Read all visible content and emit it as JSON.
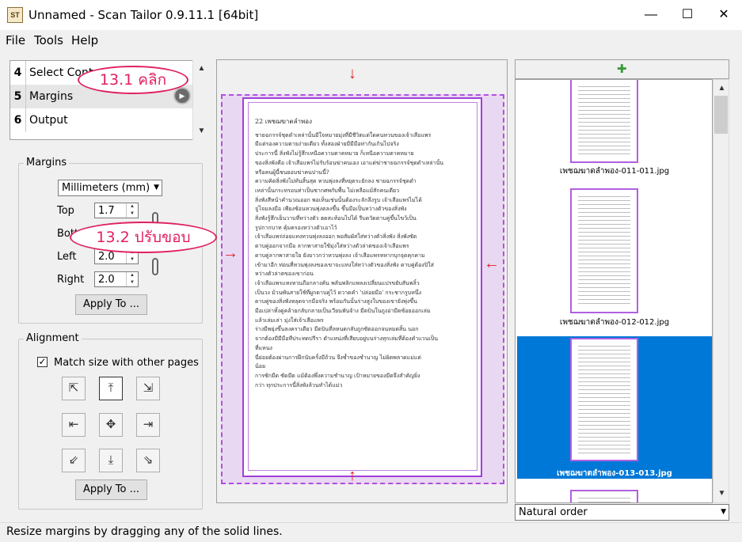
{
  "window": {
    "title": "Unnamed - Scan Tailor 0.9.11.1 [64bit]",
    "app_icon": "ST",
    "minimize_icon": "—",
    "maximize_icon": "☐",
    "close_icon": "✕"
  },
  "menu": [
    "File",
    "Tools",
    "Help"
  ],
  "stages": [
    {
      "num": "4",
      "label": "Select Cont"
    },
    {
      "num": "5",
      "label": "Margins"
    },
    {
      "num": "6",
      "label": "Output"
    }
  ],
  "margins_group": {
    "title": "Margins",
    "unit": "Millimeters (mm)",
    "top_label": "Top",
    "top_value": "1.7",
    "bottom_label": "Bott",
    "left_label": "Left",
    "left_value": "2.0",
    "right_label": "Right",
    "right_value": "2.0",
    "apply_label": "Apply To ..."
  },
  "alignment_group": {
    "title": "Alignment",
    "match_label": "Match size with other pages",
    "match_checked": true,
    "apply_label": "Apply To ..."
  },
  "page_text": {
    "header": "22  เพชฌฆาตลำพอง",
    "lines": [
      "ชายฉกรรจ์ชุดดำเหล่านั้นมีใจหมายมุ่งที่มีชีวิตแต่ใดคนหวนของเจ้าเสือแพร",
      "มีแต่รองความตายง่ายเดียว ทั้งสองฝ่ายมีมีมือท่ากันเกินไปจริง",
      "ประการนี้ สิ่งพังไม่รู้สึกเหนือความตาคหมาย ก็เหนือความตาคหมาย",
      "ของสิ่งพังคือ เจ้าเสือแพร่ไม่รับร้อนฆ่าคนเอง เอาแต่ฆ่าชายฉกรรจ์ชุดดำเหล่านั้น",
      "หรือคนผู้นี้ชนยอบฆ่าคนปานนี้?",
      "ความคิดสิ่งพังไม่ทันสิ้นสุด หวนพุ่งลงที่หยุดระยักลง ชายฉกรรจ์ชุดดำ",
      "เหล่านั้นกระทรอนท่าเป็นซากศพกับพื้น ไม่เหลือแม้สักคนเดียว",
      "สิ่งพังสีหน้าคำนวณออก พอเห็นเช่นนั้นต้องระลักลึงรูบ เจ้าเสือแพร่ไม่ได้",
      "จู่โจมลงมือ เพียงซ้อนหวนพุ่งตลงขึ้น ขึ้นมือเป็นหว่างตัวของสิ่งพัง",
      "สิ่งพังรู้สึกเย็นวาบที่หว่างตัว ฮดสะท้อนไปได้ รีบดวัดตาบคู่ขึ้นไขว้เป็น",
      "รูปกากบาท คุ้มครองหว่างตัวเอาไว้",
      "เจ้าเสือแพร่ถ่อยแทงทวนพุ่งลงออก พอสัมผัสใส่หว่างตัวสิ่งพัง สิ่งพังซัด",
      "ดาบคู่ออกจากมือ ลากพาสายใช้มุ่งใส่หว่างตัวล่าตของเจ้าเสือแพร",
      "ดาบคู่ลากพาสายใย ยังยาวกว่าหวนพุ่งลง เจ้าเสือแพรทหากบุกจุดคุกคาม",
      "เข้ามาอีก ท่อนที่หวนพุ่งลงของเขาจะแทงใส่หว่างตัวของสิ่งพัง ดาบคู่ต้องปิใส่",
      "หว่างตัวล่าตของเขาก่อน",
      "เจ้าเสือแพรแทงหวนถือกลางคัน พลันพลิกแพลงเปลี่ยนแปรขยับสันพลิ้ว",
      "เป็นวง ม้วนพันสายใช้ที่ผูกดาบคู่ไว้ ดวาดคำ 'ปล่อยมือ' กระชากรูบหนึ่ง",
      "ดาบคู่ของสิ่งพังหลุดจากมือจริง พร้อมกันนั้นร่างสูงใบของเขายังพุ่งขึ้น",
      "มือเปล่าทั้งคู่คล้ายกลับกลายเป็นเวียนพันจ้าง มีดบินในถูงอ่ามีดซ้อยออกเล่ม",
      "แล้วเล่มเล่า มุ่งใส่เจ้าเสือแพร",
      "ร่างมีพยุ่งขึ้นลงคราเดียว มีดบินที่ลหนดกลับถูกซัดออกจนหมดสิ้น นอก",
      "จากต้องมีมีมือทีประทดปรีรา ตำแหน่งที่เสียบอยู่บนร่างทุกเล่มที่ต้องคำแวนเป็น",
      "ที่แหนง",
      "นี่ย่อยต้องผ่านการฝึกนับครั้งมีถ้วน จึงซ้ำของช่ำนาญ ไม่ผิดพลาดแม่แต่",
      "น้อย",
      "การซักมีด ซัดมีด แม้ต้องพึ่งความชำนาญ เป้าหมายของมีดจึงสำคัญยิ่ง",
      "กว่า ทุกประการนี้สิ่งพังล้วนทำได้แม่ว"
    ]
  },
  "thumbnails": [
    {
      "caption": "เพชฌฆาตลำพอง-011-011.jpg",
      "selected": false
    },
    {
      "caption": "เพชฌฆาตลำพอง-012-012.jpg",
      "selected": false
    },
    {
      "caption": "เพชฌฆาตลำพอง-013-013.jpg",
      "selected": true
    }
  ],
  "sort_order": "Natural order",
  "status": "Resize margins by dragging any of the solid lines.",
  "callouts": {
    "step1": "13.1 คลิก",
    "step2": "13.2 ปรับขอบ"
  },
  "icons": {
    "play": "▶",
    "scroll_up": "▲",
    "scroll_down": "▼",
    "dropdown": "▼",
    "check": "✓",
    "arrow_down": "↓",
    "arrow_up": "↑",
    "arrow_right": "→",
    "arrow_left": "←",
    "thumb_toggle": "✚"
  },
  "colors": {
    "accent_purple": "#b050e0",
    "selection_blue": "#0078d7",
    "annotation_red": "#e02060"
  }
}
